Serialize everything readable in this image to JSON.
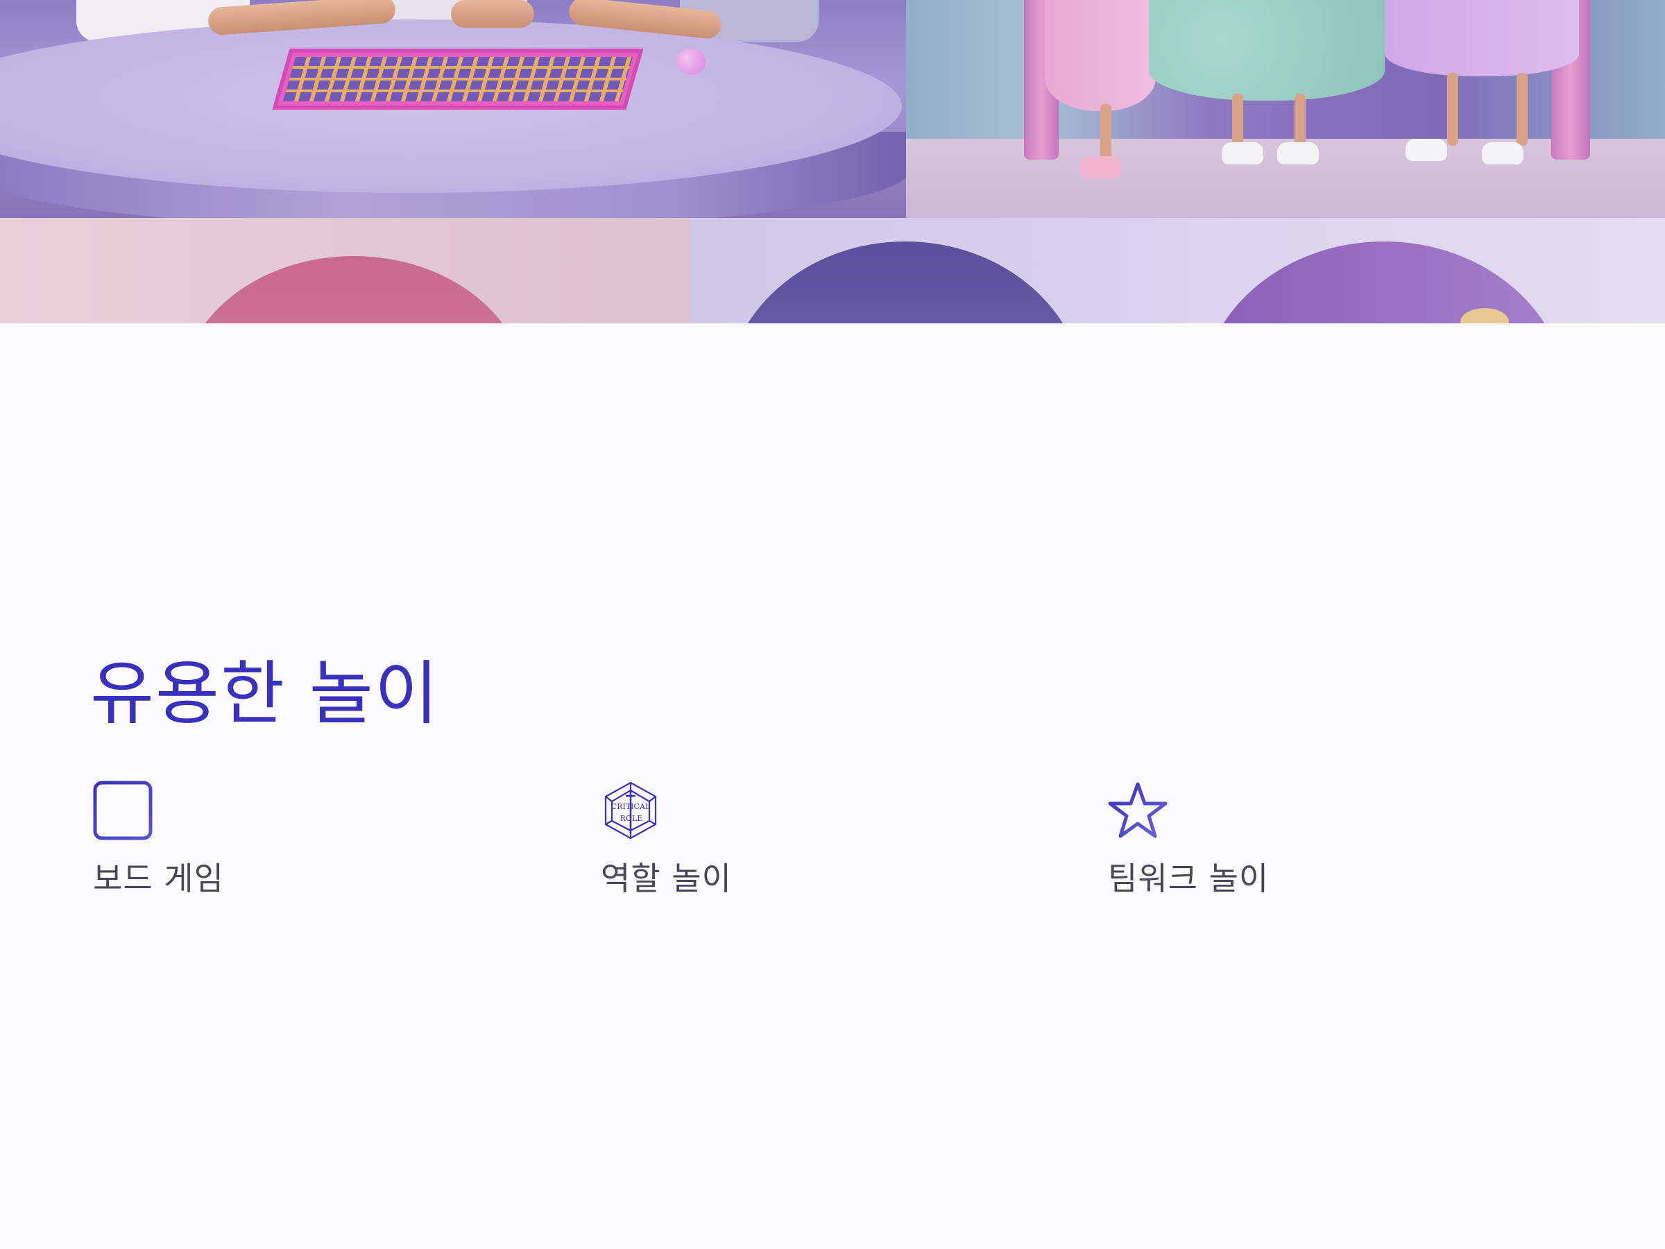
{
  "hero": {
    "image_description": ""
  },
  "section": {
    "title": "유용한 놀이"
  },
  "features": [
    {
      "label": "보드 게임",
      "icon": "grid-board-icon"
    },
    {
      "label": "역할 놀이",
      "icon": "critical-role-d20-icon",
      "icon_text": "CRITICAL ROLE"
    },
    {
      "label": "팀워크 놀이",
      "icon": "star-icon"
    }
  ],
  "colors": {
    "accent": "#3b2fbf",
    "label_text": "#4a4656",
    "background": "#fcfbfe"
  }
}
